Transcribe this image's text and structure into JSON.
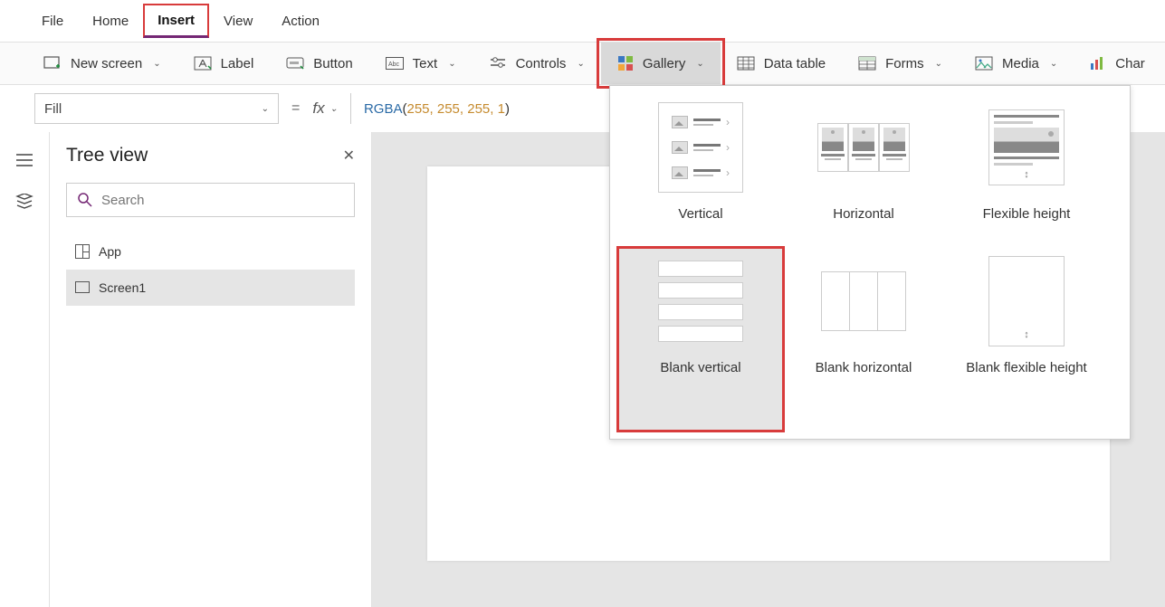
{
  "menu": {
    "file": "File",
    "home": "Home",
    "insert": "Insert",
    "view": "View",
    "action": "Action"
  },
  "ribbon": {
    "new_screen": "New screen",
    "label": "Label",
    "button": "Button",
    "text": "Text",
    "controls": "Controls",
    "gallery": "Gallery",
    "data_table": "Data table",
    "forms": "Forms",
    "media": "Media",
    "chart": "Char"
  },
  "formula": {
    "property": "Fill",
    "equals": "=",
    "fx": "fx",
    "fn": "RGBA",
    "args": [
      "255",
      "255",
      "255",
      "1"
    ]
  },
  "panel": {
    "title": "Tree view",
    "search_placeholder": "Search",
    "items": [
      "App",
      "Screen1"
    ]
  },
  "gallery_options": {
    "vertical": "Vertical",
    "horizontal": "Horizontal",
    "flexible": "Flexible height",
    "blank_vertical": "Blank vertical",
    "blank_horizontal": "Blank horizontal",
    "blank_flexible": "Blank flexible height"
  }
}
